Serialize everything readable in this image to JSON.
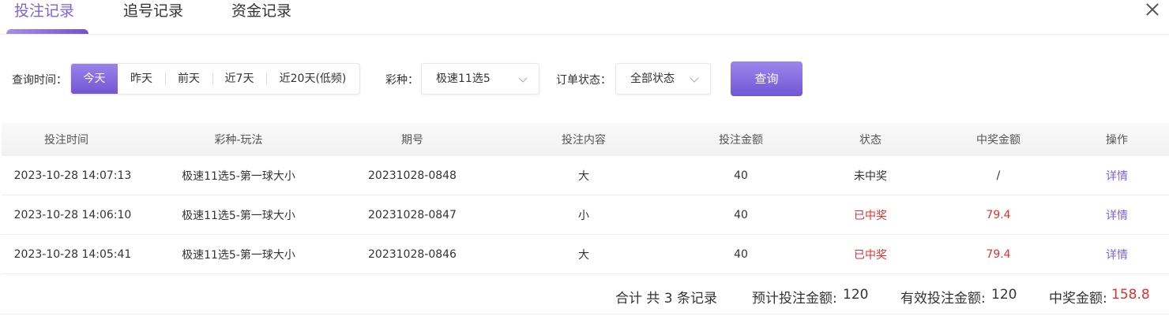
{
  "tabs": [
    {
      "label": "投注记录",
      "active": true
    },
    {
      "label": "追号记录",
      "active": false
    },
    {
      "label": "资金记录",
      "active": false
    }
  ],
  "filters": {
    "time_label": "查询时间：",
    "time_options": [
      "今天",
      "昨天",
      "前天",
      "近7天",
      "近20天(低频)"
    ],
    "time_selected": "今天",
    "lottery_label": "彩种：",
    "lottery_value": "极速11选5",
    "status_label": "订单状态：",
    "status_value": "全部状态",
    "query_button": "查询"
  },
  "table": {
    "columns": [
      "投注时间",
      "彩种-玩法",
      "期号",
      "投注内容",
      "投注金额",
      "状态",
      "中奖金额",
      "操作"
    ],
    "rows": [
      {
        "time": "2023-10-28 14:07:13",
        "game": "极速11选5-第一球大小",
        "issue": "20231028-0848",
        "content": "大",
        "amount": "40",
        "status": "未中奖",
        "prize": "/",
        "action": "详情"
      },
      {
        "time": "2023-10-28 14:06:10",
        "game": "极速11选5-第一球大小",
        "issue": "20231028-0847",
        "content": "小",
        "amount": "40",
        "status": "已中奖",
        "prize": "79.4",
        "action": "详情"
      },
      {
        "time": "2023-10-28 14:05:41",
        "game": "极速11选5-第一球大小",
        "issue": "20231028-0846",
        "content": "大",
        "amount": "40",
        "status": "已中奖",
        "prize": "79.4",
        "action": "详情"
      }
    ]
  },
  "summary": {
    "total_records": "合计 共 3 条记录",
    "expected_label": "预计投注金额:",
    "expected_value": "120",
    "valid_label": "有效投注金额:",
    "valid_value": "120",
    "prize_label": "中奖金额:",
    "prize_value": "158.8"
  },
  "colors": {
    "accent": "#7b62d6",
    "win": "#e2302c"
  }
}
